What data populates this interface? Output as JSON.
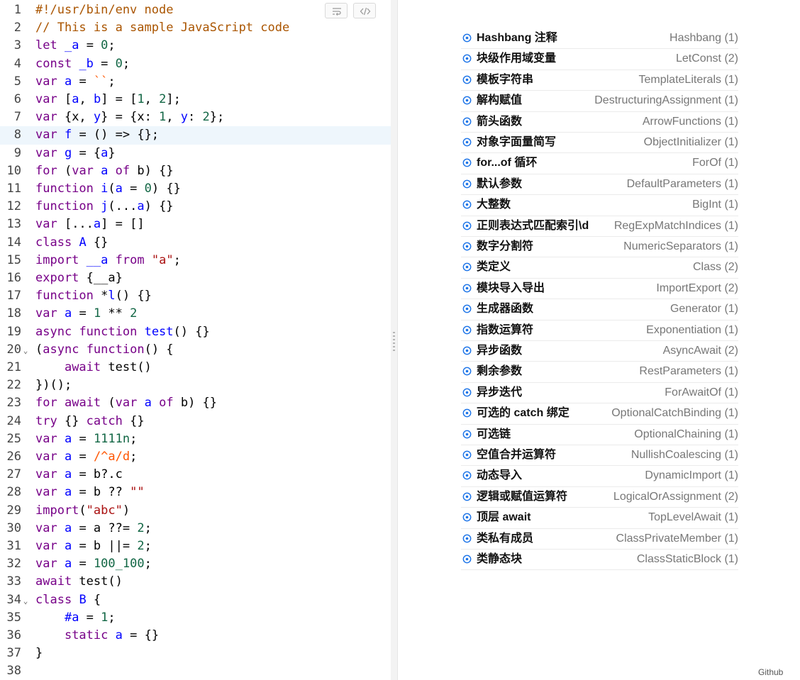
{
  "editor": {
    "active_line": 8,
    "fold_marker": "⌄",
    "lines": [
      {
        "n": "1",
        "tokens": [
          {
            "t": "#!/usr/bin/env node",
            "c": "cm"
          }
        ]
      },
      {
        "n": "2",
        "tokens": [
          {
            "t": "// This is a sample JavaScript code",
            "c": "cm"
          }
        ]
      },
      {
        "n": "3",
        "tokens": [
          {
            "t": "let",
            "c": "kw"
          },
          {
            "t": " "
          },
          {
            "t": "_a",
            "c": "def"
          },
          {
            "t": " = "
          },
          {
            "t": "0",
            "c": "num"
          },
          {
            "t": ";"
          }
        ]
      },
      {
        "n": "4",
        "tokens": [
          {
            "t": "const",
            "c": "kw"
          },
          {
            "t": " "
          },
          {
            "t": "_b",
            "c": "def"
          },
          {
            "t": " = "
          },
          {
            "t": "0",
            "c": "num"
          },
          {
            "t": ";"
          }
        ]
      },
      {
        "n": "5",
        "tokens": [
          {
            "t": "var",
            "c": "kw"
          },
          {
            "t": " "
          },
          {
            "t": "a",
            "c": "def"
          },
          {
            "t": " = "
          },
          {
            "t": "``",
            "c": "str2"
          },
          {
            "t": ";"
          }
        ]
      },
      {
        "n": "6",
        "tokens": [
          {
            "t": "var",
            "c": "kw"
          },
          {
            "t": " ["
          },
          {
            "t": "a",
            "c": "def"
          },
          {
            "t": ", "
          },
          {
            "t": "b",
            "c": "def"
          },
          {
            "t": "] = ["
          },
          {
            "t": "1",
            "c": "num"
          },
          {
            "t": ", "
          },
          {
            "t": "2",
            "c": "num"
          },
          {
            "t": "];"
          }
        ]
      },
      {
        "n": "7",
        "tokens": [
          {
            "t": "var",
            "c": "kw"
          },
          {
            "t": " {x, "
          },
          {
            "t": "y",
            "c": "def"
          },
          {
            "t": "} = {x: "
          },
          {
            "t": "1",
            "c": "num"
          },
          {
            "t": ", "
          },
          {
            "t": "y",
            "c": "def"
          },
          {
            "t": ": "
          },
          {
            "t": "2",
            "c": "num"
          },
          {
            "t": "};"
          }
        ]
      },
      {
        "n": "8",
        "tokens": [
          {
            "t": "var",
            "c": "kw"
          },
          {
            "t": " "
          },
          {
            "t": "f",
            "c": "def"
          },
          {
            "t": " = () => {};"
          }
        ]
      },
      {
        "n": "9",
        "tokens": [
          {
            "t": "var",
            "c": "kw"
          },
          {
            "t": " "
          },
          {
            "t": "g",
            "c": "def"
          },
          {
            "t": " = {"
          },
          {
            "t": "a",
            "c": "def"
          },
          {
            "t": "}"
          }
        ]
      },
      {
        "n": "10",
        "tokens": [
          {
            "t": "for",
            "c": "kw"
          },
          {
            "t": " ("
          },
          {
            "t": "var",
            "c": "kw"
          },
          {
            "t": " "
          },
          {
            "t": "a",
            "c": "def"
          },
          {
            "t": " "
          },
          {
            "t": "of",
            "c": "kw"
          },
          {
            "t": " b) {}"
          }
        ]
      },
      {
        "n": "11",
        "tokens": [
          {
            "t": "function",
            "c": "kw"
          },
          {
            "t": " "
          },
          {
            "t": "i",
            "c": "def"
          },
          {
            "t": "("
          },
          {
            "t": "a",
            "c": "def"
          },
          {
            "t": " = "
          },
          {
            "t": "0",
            "c": "num"
          },
          {
            "t": ") {}"
          }
        ]
      },
      {
        "n": "12",
        "tokens": [
          {
            "t": "function",
            "c": "kw"
          },
          {
            "t": " "
          },
          {
            "t": "j",
            "c": "def"
          },
          {
            "t": "(..."
          },
          {
            "t": "a",
            "c": "def"
          },
          {
            "t": ") {}"
          }
        ]
      },
      {
        "n": "13",
        "tokens": [
          {
            "t": "var",
            "c": "kw"
          },
          {
            "t": " [..."
          },
          {
            "t": "a",
            "c": "def"
          },
          {
            "t": "] = []"
          }
        ]
      },
      {
        "n": "14",
        "tokens": [
          {
            "t": "class",
            "c": "kw"
          },
          {
            "t": " "
          },
          {
            "t": "A",
            "c": "def"
          },
          {
            "t": " {}"
          }
        ]
      },
      {
        "n": "15",
        "tokens": [
          {
            "t": "import",
            "c": "kw"
          },
          {
            "t": " "
          },
          {
            "t": "__a",
            "c": "def"
          },
          {
            "t": " "
          },
          {
            "t": "from",
            "c": "kw"
          },
          {
            "t": " "
          },
          {
            "t": "\"a\"",
            "c": "str"
          },
          {
            "t": ";"
          }
        ]
      },
      {
        "n": "16",
        "tokens": [
          {
            "t": "export",
            "c": "kw"
          },
          {
            "t": " {__a}"
          }
        ]
      },
      {
        "n": "17",
        "tokens": [
          {
            "t": "function",
            "c": "kw"
          },
          {
            "t": " *"
          },
          {
            "t": "l",
            "c": "def"
          },
          {
            "t": "() {}"
          }
        ]
      },
      {
        "n": "18",
        "tokens": [
          {
            "t": "var",
            "c": "kw"
          },
          {
            "t": " "
          },
          {
            "t": "a",
            "c": "def"
          },
          {
            "t": " = "
          },
          {
            "t": "1",
            "c": "num"
          },
          {
            "t": " ** "
          },
          {
            "t": "2",
            "c": "num"
          }
        ]
      },
      {
        "n": "19",
        "tokens": [
          {
            "t": "async",
            "c": "kw"
          },
          {
            "t": " "
          },
          {
            "t": "function",
            "c": "kw"
          },
          {
            "t": " "
          },
          {
            "t": "test",
            "c": "def"
          },
          {
            "t": "() {}"
          }
        ]
      },
      {
        "n": "20",
        "fold": true,
        "tokens": [
          {
            "t": "("
          },
          {
            "t": "async",
            "c": "kw"
          },
          {
            "t": " "
          },
          {
            "t": "function",
            "c": "kw"
          },
          {
            "t": "() {"
          }
        ]
      },
      {
        "n": "21",
        "tokens": [
          {
            "t": "    "
          },
          {
            "t": "await",
            "c": "kw"
          },
          {
            "t": " test()"
          }
        ]
      },
      {
        "n": "22",
        "tokens": [
          {
            "t": "})();"
          }
        ]
      },
      {
        "n": "23",
        "tokens": [
          {
            "t": "for",
            "c": "kw"
          },
          {
            "t": " "
          },
          {
            "t": "await",
            "c": "kw"
          },
          {
            "t": " ("
          },
          {
            "t": "var",
            "c": "kw"
          },
          {
            "t": " "
          },
          {
            "t": "a",
            "c": "def"
          },
          {
            "t": " "
          },
          {
            "t": "of",
            "c": "kw"
          },
          {
            "t": " b) {}"
          }
        ]
      },
      {
        "n": "24",
        "tokens": [
          {
            "t": "try",
            "c": "kw"
          },
          {
            "t": " {} "
          },
          {
            "t": "catch",
            "c": "kw"
          },
          {
            "t": " {}"
          }
        ]
      },
      {
        "n": "25",
        "tokens": [
          {
            "t": "var",
            "c": "kw"
          },
          {
            "t": " "
          },
          {
            "t": "a",
            "c": "def"
          },
          {
            "t": " = "
          },
          {
            "t": "1111n",
            "c": "num"
          },
          {
            "t": ";"
          }
        ]
      },
      {
        "n": "26",
        "tokens": [
          {
            "t": "var",
            "c": "kw"
          },
          {
            "t": " "
          },
          {
            "t": "a",
            "c": "def"
          },
          {
            "t": " = "
          },
          {
            "t": "/^a/d",
            "c": "str2"
          },
          {
            "t": ";"
          }
        ]
      },
      {
        "n": "27",
        "tokens": [
          {
            "t": "var",
            "c": "kw"
          },
          {
            "t": " "
          },
          {
            "t": "a",
            "c": "def"
          },
          {
            "t": " = b?.c"
          }
        ]
      },
      {
        "n": "28",
        "tokens": [
          {
            "t": "var",
            "c": "kw"
          },
          {
            "t": " "
          },
          {
            "t": "a",
            "c": "def"
          },
          {
            "t": " = b ?? "
          },
          {
            "t": "\"\"",
            "c": "str"
          }
        ]
      },
      {
        "n": "29",
        "tokens": [
          {
            "t": "import",
            "c": "kw"
          },
          {
            "t": "("
          },
          {
            "t": "\"abc\"",
            "c": "str"
          },
          {
            "t": ")"
          }
        ]
      },
      {
        "n": "30",
        "tokens": [
          {
            "t": "var",
            "c": "kw"
          },
          {
            "t": " "
          },
          {
            "t": "a",
            "c": "def"
          },
          {
            "t": " = a ??= "
          },
          {
            "t": "2",
            "c": "num"
          },
          {
            "t": ";"
          }
        ]
      },
      {
        "n": "31",
        "tokens": [
          {
            "t": "var",
            "c": "kw"
          },
          {
            "t": " "
          },
          {
            "t": "a",
            "c": "def"
          },
          {
            "t": " = b ||= "
          },
          {
            "t": "2",
            "c": "num"
          },
          {
            "t": ";"
          }
        ]
      },
      {
        "n": "32",
        "tokens": [
          {
            "t": "var",
            "c": "kw"
          },
          {
            "t": " "
          },
          {
            "t": "a",
            "c": "def"
          },
          {
            "t": " = "
          },
          {
            "t": "100_100",
            "c": "num"
          },
          {
            "t": ";"
          }
        ]
      },
      {
        "n": "33",
        "tokens": [
          {
            "t": "await",
            "c": "kw"
          },
          {
            "t": " test()"
          }
        ]
      },
      {
        "n": "34",
        "fold": true,
        "tokens": [
          {
            "t": "class",
            "c": "kw"
          },
          {
            "t": " "
          },
          {
            "t": "B",
            "c": "def"
          },
          {
            "t": " {"
          }
        ]
      },
      {
        "n": "35",
        "tokens": [
          {
            "t": "    "
          },
          {
            "t": "#a",
            "c": "def"
          },
          {
            "t": " = "
          },
          {
            "t": "1",
            "c": "num"
          },
          {
            "t": ";"
          }
        ]
      },
      {
        "n": "36",
        "tokens": [
          {
            "t": "    "
          },
          {
            "t": "static",
            "c": "kw"
          },
          {
            "t": " "
          },
          {
            "t": "a",
            "c": "def"
          },
          {
            "t": " = {}"
          }
        ]
      },
      {
        "n": "37",
        "tokens": [
          {
            "t": "}"
          }
        ]
      },
      {
        "n": "38",
        "tokens": []
      }
    ]
  },
  "toolbar": {
    "wrap_icon": "wrap-lines-icon",
    "code_icon": "code-view-icon"
  },
  "features": [
    {
      "zh": "Hashbang 注释",
      "en": "Hashbang (1)"
    },
    {
      "zh": "块级作用域变量",
      "en": "LetConst (2)"
    },
    {
      "zh": "模板字符串",
      "en": "TemplateLiterals (1)"
    },
    {
      "zh": "解构赋值",
      "en": "DestructuringAssignment (1)"
    },
    {
      "zh": "箭头函数",
      "en": "ArrowFunctions (1)"
    },
    {
      "zh": "对象字面量简写",
      "en": "ObjectInitializer (1)"
    },
    {
      "zh": "for...of 循环",
      "en": "ForOf (1)"
    },
    {
      "zh": "默认参数",
      "en": "DefaultParameters (1)"
    },
    {
      "zh": "大整数",
      "en": "BigInt (1)"
    },
    {
      "zh": "正则表达式匹配索引\\d",
      "en": "RegExpMatchIndices (1)"
    },
    {
      "zh": "数字分割符",
      "en": "NumericSeparators (1)"
    },
    {
      "zh": "类定义",
      "en": "Class (2)"
    },
    {
      "zh": "模块导入导出",
      "en": "ImportExport (2)"
    },
    {
      "zh": "生成器函数",
      "en": "Generator (1)"
    },
    {
      "zh": "指数运算符",
      "en": "Exponentiation (1)"
    },
    {
      "zh": "异步函数",
      "en": "AsyncAwait (2)"
    },
    {
      "zh": "剩余参数",
      "en": "RestParameters (1)"
    },
    {
      "zh": "异步迭代",
      "en": "ForAwaitOf (1)"
    },
    {
      "zh": "可选的 catch 绑定",
      "en": "OptionalCatchBinding (1)"
    },
    {
      "zh": "可选链",
      "en": "OptionalChaining (1)"
    },
    {
      "zh": "空值合并运算符",
      "en": "NullishCoalescing (1)"
    },
    {
      "zh": "动态导入",
      "en": "DynamicImport (1)"
    },
    {
      "zh": "逻辑或赋值运算符",
      "en": "LogicalOrAssignment (2)"
    },
    {
      "zh": "顶层 await",
      "en": "TopLevelAwait (1)"
    },
    {
      "zh": "类私有成员",
      "en": "ClassPrivateMember (1)"
    },
    {
      "zh": "类静态块",
      "en": "ClassStaticBlock (1)"
    }
  ],
  "colors": {
    "accent": "#1a73e8",
    "active_line": "#eef6fc"
  },
  "footer": {
    "link": "Github"
  }
}
